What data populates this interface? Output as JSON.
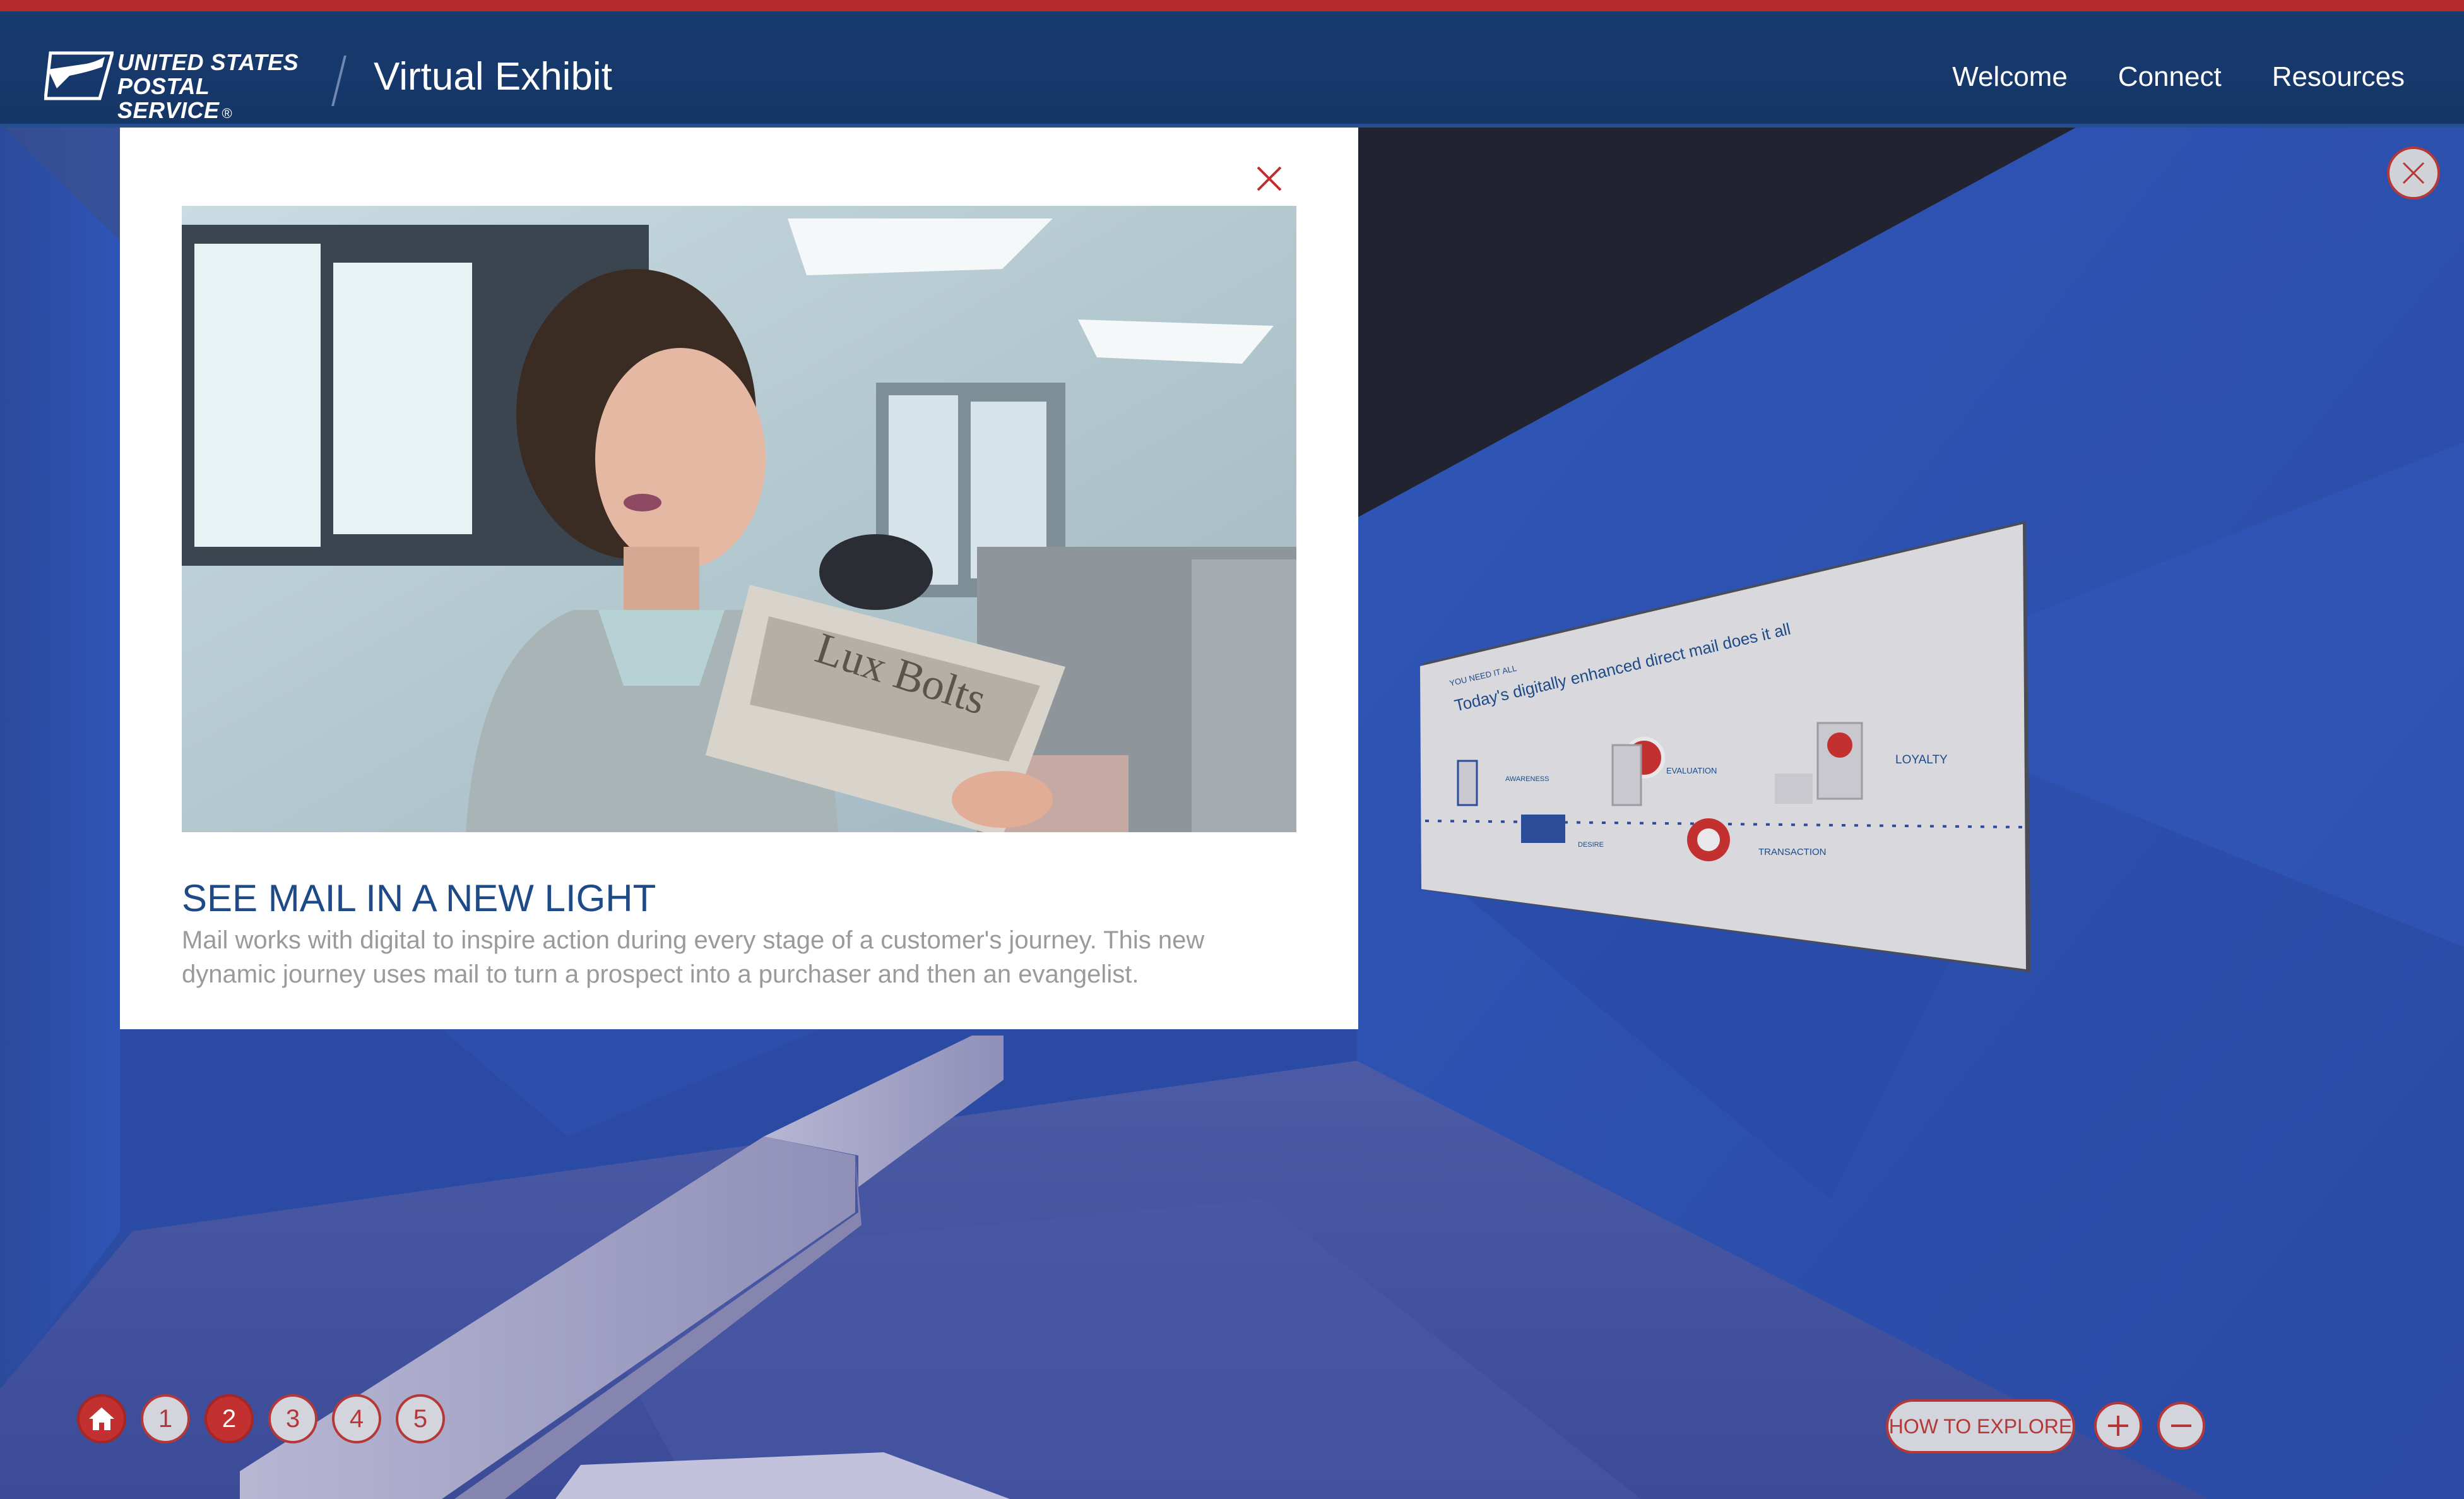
{
  "header": {
    "logo_line1": "UNITED STATES",
    "logo_line2": "POSTAL SERVICE",
    "logo_reg": "®",
    "app_title": "Virtual Exhibit",
    "nav": [
      {
        "label": "Welcome"
      },
      {
        "label": "Connect"
      },
      {
        "label": "Resources"
      }
    ]
  },
  "modal": {
    "title": "SEE MAIL IN A NEW LIGHT",
    "body": "Mail works with digital to inspire action during every stage of a customer's journey. This new dynamic journey uses mail to turn a prospect into a purchaser and then an evangelist."
  },
  "wall_panel": {
    "eyebrow": "YOU NEED IT ALL",
    "headline": "Today's digitally enhanced direct mail does it all",
    "stages": [
      "AWARENESS",
      "EVALUATION",
      "DESIRE",
      "TRANSACTION",
      "LOYALTY"
    ]
  },
  "bottom_nav": {
    "home_icon": "home-icon",
    "stops": [
      {
        "label": "1",
        "active": false
      },
      {
        "label": "2",
        "active": true
      },
      {
        "label": "3",
        "active": false
      },
      {
        "label": "4",
        "active": false
      },
      {
        "label": "5",
        "active": false
      }
    ],
    "how_to_explore": "HOW TO EXPLORE",
    "zoom_in_icon": "plus-icon",
    "zoom_out_icon": "minus-icon"
  },
  "colors": {
    "brand_blue": "#163667",
    "accent_red": "#b52a2a",
    "wall_blue": "#2a4db0",
    "title_blue": "#1e4a87"
  }
}
